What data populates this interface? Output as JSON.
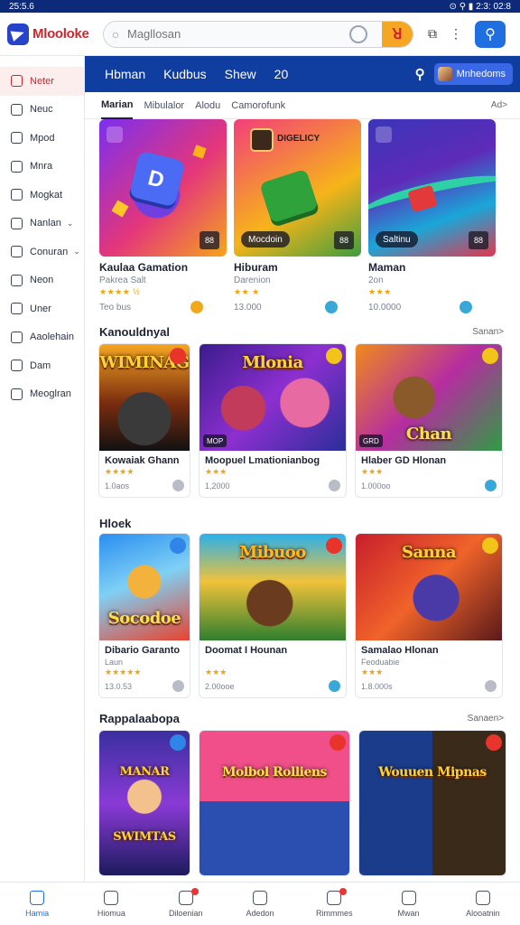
{
  "statusbar": {
    "time": "25:5.6",
    "right": "⊙ ⚲ ▮ 2:3: 02:8"
  },
  "app": {
    "name": "Mlooloke"
  },
  "search": {
    "placeholder": "Magllosan",
    "go_label": "ꓤ"
  },
  "sidebar": {
    "items": [
      {
        "label": "Neter",
        "active": true
      },
      {
        "label": "Neuc"
      },
      {
        "label": "Mpod"
      },
      {
        "label": "Mnra"
      },
      {
        "label": "Mogkat"
      },
      {
        "label": "Nanlan",
        "chevron": true
      },
      {
        "label": "Conuran",
        "chevron": true
      },
      {
        "label": "Neon"
      },
      {
        "label": "Uner"
      },
      {
        "label": "Aaolehain"
      },
      {
        "label": "Dam"
      },
      {
        "label": "Meoglran"
      }
    ]
  },
  "navbar": {
    "items": [
      "Hbman",
      "Kudbus",
      "Shew",
      "20"
    ],
    "user_label": "Mnhedoms"
  },
  "subtabs": {
    "items": [
      "Marian",
      "Mibulalor",
      "Alodu",
      "Camorofunk"
    ],
    "more": "Ad>"
  },
  "featured": [
    {
      "title": "Kaulaa Gamation",
      "sub": "Pakrea  Salt",
      "stars": "★★★★ ½",
      "meta": "Teo bus",
      "pill": "",
      "sq": "88",
      "accent": "#f0a91d"
    },
    {
      "title": "Hiburam",
      "sub": "Darenion",
      "stars": "★★ ★",
      "meta": "13.000",
      "pill": "Mocdoin",
      "sq": "88",
      "accent": "#38a8d8"
    },
    {
      "title": "Maman",
      "sub": "2on",
      "stars": "★★★",
      "meta": "10.0000",
      "pill": "Saltinu",
      "sq": "88",
      "accent": "#38a8d8"
    }
  ],
  "section1": {
    "title": "Kanouldnyal",
    "more": "Sanan>"
  },
  "row1": [
    {
      "title": "Kowaiak Ghann",
      "sub": "",
      "stars": "★★★★",
      "meta": "1.0aos",
      "art": "WIMINAG",
      "cap": "",
      "corner": "#e8342b",
      "dot": "#b7bcc7"
    },
    {
      "title": "Moopuel Lmationianbog",
      "sub": "",
      "stars": "★★★",
      "meta": "1,2000",
      "art": "Mlonia",
      "cap": "MOP",
      "corner": "#f2c318",
      "dot": "#b7bcc7"
    },
    {
      "title": "Hlaber GD Hlonan",
      "sub": "",
      "stars": "★★★",
      "meta": "1.000oo",
      "art": "Chan",
      "cap": "GRD",
      "corner": "#f2c318",
      "dot": "#38a8d8"
    }
  ],
  "section2": {
    "title": "Hloek"
  },
  "row2": [
    {
      "title": "Dibario Garanto",
      "sub": "Laun",
      "stars": "★★★★★",
      "meta": "13.0.53",
      "art": "Socodoe",
      "cap": "",
      "corner": "#2f86e8",
      "dot": "#b7bcc7"
    },
    {
      "title": "Doomat I Hounan",
      "sub": "",
      "stars": "★★★",
      "meta": "2.00ooe",
      "art": "Mibuoo",
      "cap": "",
      "corner": "#e8342b",
      "dot": "#38a8d8"
    },
    {
      "title": "Samalao Hlonan",
      "sub": "Feoduabie",
      "stars": "★★★",
      "meta": "1.8.000s",
      "art": "Sanna",
      "cap": "",
      "corner": "#f2c318",
      "dot": "#b7bcc7"
    }
  ],
  "section3": {
    "title": "Rappalaabopa",
    "more": "Sanaen>"
  },
  "row3": [
    {
      "art": "MANAR SWIMTAS",
      "corner": "#2f86e8"
    },
    {
      "art": "Molbol Rolliens",
      "corner": "#e8342b"
    },
    {
      "art": "Wouuen Mipnas",
      "corner": "#e8342b"
    }
  ],
  "bottomnav": [
    {
      "label": "Hamia",
      "active": true
    },
    {
      "label": "Hiomua"
    },
    {
      "label": "Diloenian",
      "notif": true
    },
    {
      "label": "Adedon"
    },
    {
      "label": "Rimmmes",
      "notif": true
    },
    {
      "label": "Mwan"
    },
    {
      "label": "Alooatnin"
    }
  ]
}
